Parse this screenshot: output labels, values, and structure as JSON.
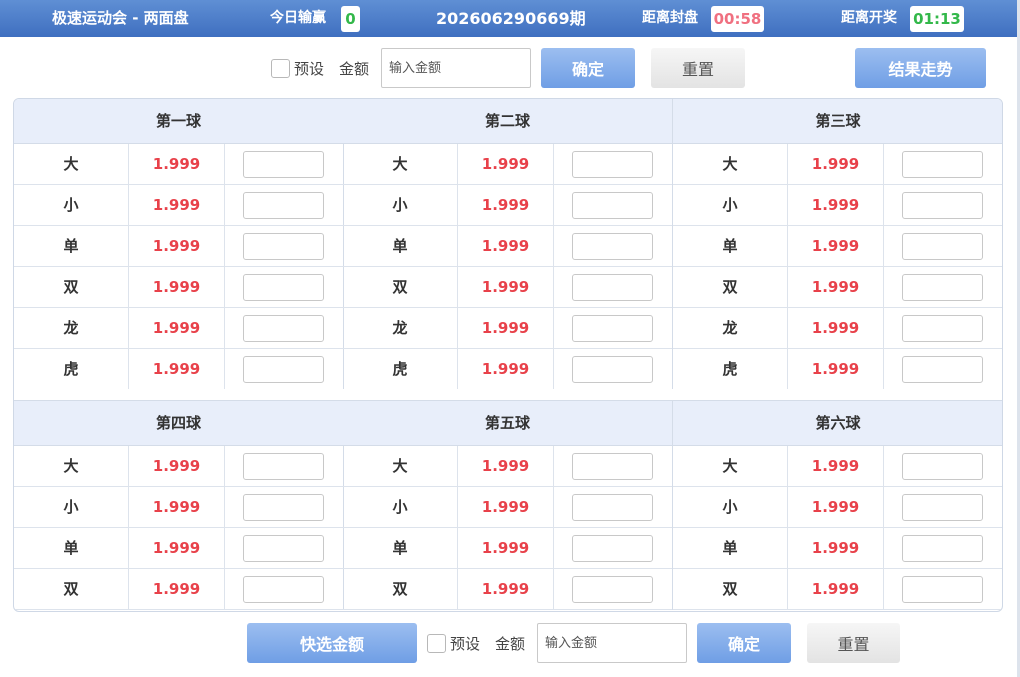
{
  "header": {
    "title": "极速运动会 - 两面盘",
    "today_label": "今日输赢",
    "today_value": "0",
    "issue": "202606290669期",
    "close_label": "距离封盘",
    "close_time": "00:58",
    "draw_label": "距离开奖",
    "draw_time": "01:13",
    "colors": {
      "close_time": "#f07080",
      "draw_time": "#33b84a",
      "today_value": "#33b84a"
    }
  },
  "toolbar_top": {
    "preset_label": "预设",
    "amount_label": "金额",
    "amount_placeholder": "输入金额",
    "confirm_label": "确定",
    "reset_label": "重置",
    "trend_label": "结果走势"
  },
  "toolbar_bottom": {
    "quick_amount_label": "快选金额",
    "preset_label": "预设",
    "amount_label": "金额",
    "amount_placeholder": "输入金额",
    "confirm_label": "确定",
    "reset_label": "重置"
  },
  "sections": [
    {
      "balls": [
        {
          "title": "第一球",
          "rows": [
            {
              "name": "大",
              "odds": "1.999"
            },
            {
              "name": "小",
              "odds": "1.999"
            },
            {
              "name": "单",
              "odds": "1.999"
            },
            {
              "name": "双",
              "odds": "1.999"
            },
            {
              "name": "龙",
              "odds": "1.999"
            },
            {
              "name": "虎",
              "odds": "1.999"
            }
          ]
        },
        {
          "title": "第二球",
          "rows": [
            {
              "name": "大",
              "odds": "1.999"
            },
            {
              "name": "小",
              "odds": "1.999"
            },
            {
              "name": "单",
              "odds": "1.999"
            },
            {
              "name": "双",
              "odds": "1.999"
            },
            {
              "name": "龙",
              "odds": "1.999"
            },
            {
              "name": "虎",
              "odds": "1.999"
            }
          ]
        },
        {
          "title": "第三球",
          "rows": [
            {
              "name": "大",
              "odds": "1.999"
            },
            {
              "name": "小",
              "odds": "1.999"
            },
            {
              "name": "单",
              "odds": "1.999"
            },
            {
              "name": "双",
              "odds": "1.999"
            },
            {
              "name": "龙",
              "odds": "1.999"
            },
            {
              "name": "虎",
              "odds": "1.999"
            }
          ]
        }
      ]
    },
    {
      "balls": [
        {
          "title": "第四球",
          "rows": [
            {
              "name": "大",
              "odds": "1.999"
            },
            {
              "name": "小",
              "odds": "1.999"
            },
            {
              "name": "单",
              "odds": "1.999"
            },
            {
              "name": "双",
              "odds": "1.999"
            }
          ]
        },
        {
          "title": "第五球",
          "rows": [
            {
              "name": "大",
              "odds": "1.999"
            },
            {
              "name": "小",
              "odds": "1.999"
            },
            {
              "name": "单",
              "odds": "1.999"
            },
            {
              "name": "双",
              "odds": "1.999"
            }
          ]
        },
        {
          "title": "第六球",
          "rows": [
            {
              "name": "大",
              "odds": "1.999"
            },
            {
              "name": "小",
              "odds": "1.999"
            },
            {
              "name": "单",
              "odds": "1.999"
            },
            {
              "name": "双",
              "odds": "1.999"
            }
          ]
        }
      ]
    }
  ]
}
